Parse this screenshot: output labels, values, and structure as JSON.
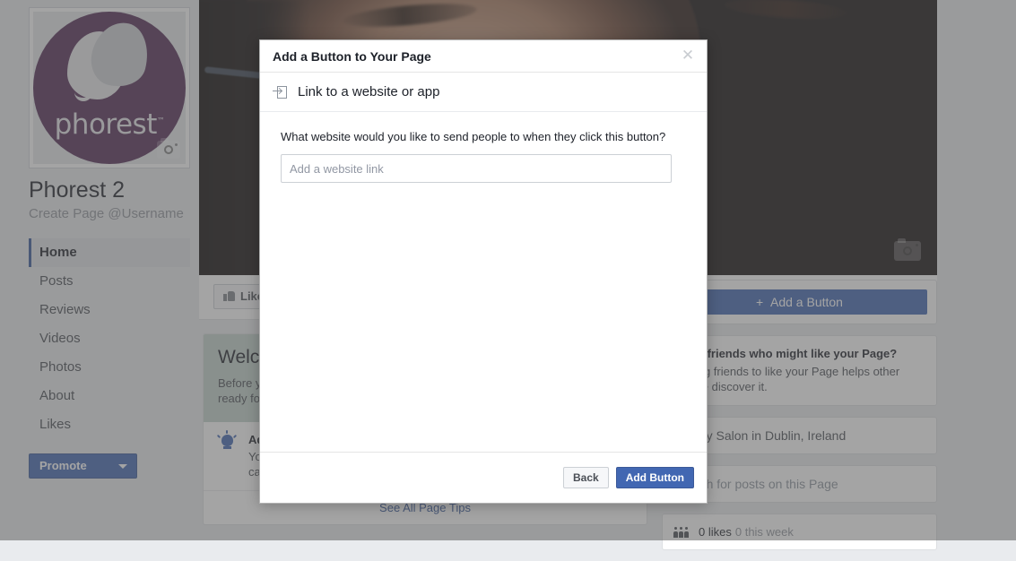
{
  "page": {
    "profile": {
      "logo_word": "phorest",
      "logo_tm": "™",
      "name": "Phorest 2",
      "subtitle": "Create Page @Username",
      "photo_camera_icon": "camera-icon"
    },
    "nav": {
      "items": [
        {
          "label": "Home",
          "active": true
        },
        {
          "label": "Posts",
          "active": false
        },
        {
          "label": "Reviews",
          "active": false
        },
        {
          "label": "Videos",
          "active": false
        },
        {
          "label": "Photos",
          "active": false
        },
        {
          "label": "About",
          "active": false
        },
        {
          "label": "Likes",
          "active": false
        }
      ]
    },
    "promote": {
      "label": "Promote",
      "caret_icon": "chevron-down-icon"
    },
    "cover": {
      "camera_icon": "camera-icon"
    },
    "action_bar": {
      "like_label": "Like",
      "like_icon": "thumbs-up-icon"
    },
    "welcome_card": {
      "title": "Welcome to Your New Page",
      "body": "Before you share your Page with the world, we can help you set it up so it's ready for visitors. We'll give you tips along the way.",
      "tip": {
        "icon": "lightbulb-icon",
        "title": "Add a Button to Your Page",
        "body": "You can add a button to your Page so people can take an action, like calling you or visiting your website."
      },
      "footer_link": "See All Page Tips"
    },
    "right_column": {
      "cta_button": {
        "label": "Add a Button",
        "plus_icon": "plus-icon"
      },
      "invite_card": {
        "title": "Invite friends who might like your Page?",
        "body": "Inviting friends to like your Page helps other people discover it."
      },
      "location_card": {
        "text": "Beauty Salon in Dublin, Ireland"
      },
      "search_card": {
        "placeholder": "Search for posts on this Page"
      },
      "likes_card": {
        "icon": "people-icon",
        "count": "0 likes",
        "trend": "0 this week"
      }
    }
  },
  "modal": {
    "title": "Add a Button to Your Page",
    "close_icon": "close-icon",
    "section": {
      "icon": "link-to-app-icon",
      "label": "Link to a website or app"
    },
    "question": "What website would you like to send people to when they click this button?",
    "input": {
      "value": "",
      "placeholder": "Add a website link"
    },
    "back_label": "Back",
    "submit_label": "Add Button"
  },
  "colors": {
    "brand_blue": "#4267b2",
    "logo_purple": "#522b56",
    "welcome_header": "#c3d2cc"
  }
}
